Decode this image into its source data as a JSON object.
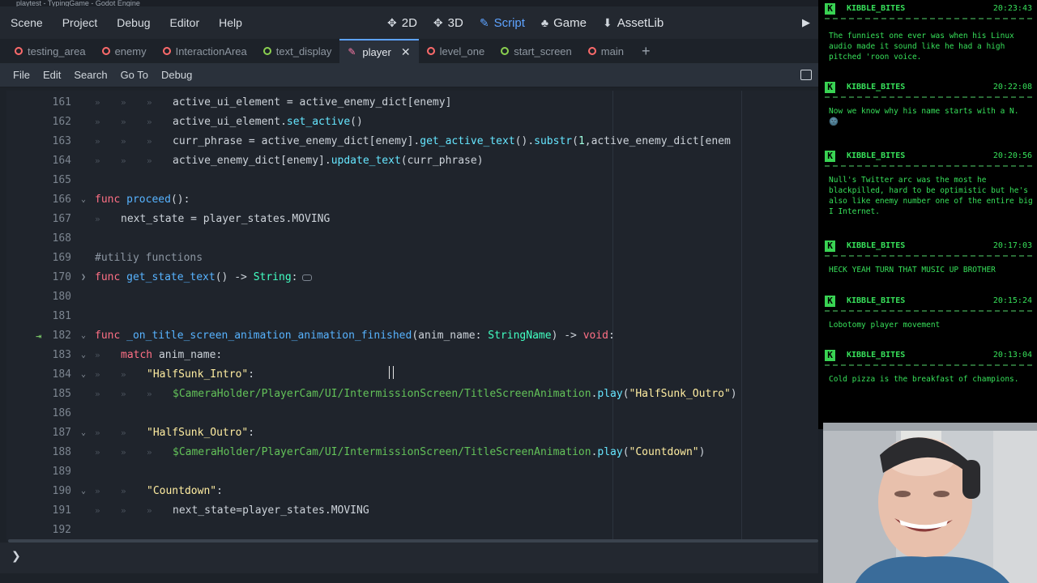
{
  "os_title": "playtest - TypingGame - Godot Engine",
  "menu": [
    "Scene",
    "Project",
    "Debug",
    "Editor",
    "Help"
  ],
  "workspaces": [
    {
      "icon": "✥",
      "label": "2D",
      "active": false
    },
    {
      "icon": "✥",
      "label": "3D",
      "active": false
    },
    {
      "icon": "✎",
      "label": "Script",
      "active": true
    },
    {
      "icon": "♣",
      "label": "Game",
      "active": false
    },
    {
      "icon": "⬇",
      "label": "AssetLib",
      "active": false
    }
  ],
  "tabs": [
    {
      "label": "testing_area",
      "color": "#ff6b6b",
      "active": false
    },
    {
      "label": "enemy",
      "color": "#ff6b6b",
      "active": false
    },
    {
      "label": "InteractionArea",
      "color": "#ff6b6b",
      "active": false
    },
    {
      "label": "text_display",
      "color": "#8bd150",
      "active": false
    },
    {
      "label": "player",
      "color": "#ff7aa8",
      "active": true
    },
    {
      "label": "level_one",
      "color": "#ff6b6b",
      "active": false
    },
    {
      "label": "start_screen",
      "color": "#8bd150",
      "active": false
    },
    {
      "label": "main",
      "color": "#ff6b6b",
      "active": false
    }
  ],
  "script_menu": [
    "File",
    "Edit",
    "Search",
    "Go To",
    "Debug"
  ],
  "code_lines": [
    {
      "n": "161",
      "indent": 3,
      "text": "active_ui_element = active_enemy_dict[enemy]"
    },
    {
      "n": "162",
      "indent": 3,
      "text": "active_ui_element.set_active()"
    },
    {
      "n": "163",
      "indent": 3,
      "text": "curr_phrase = active_enemy_dict[enemy].get_active_text().substr(1,active_enemy_dict[enem"
    },
    {
      "n": "164",
      "indent": 3,
      "text": "active_enemy_dict[enemy].update_text(curr_phrase)"
    },
    {
      "n": "165",
      "indent": 0,
      "text": ""
    },
    {
      "n": "166",
      "indent": 0,
      "text": "func proceed():"
    },
    {
      "n": "167",
      "indent": 1,
      "text": "next_state = player_states.MOVING"
    },
    {
      "n": "168",
      "indent": 0,
      "text": ""
    },
    {
      "n": "169",
      "indent": 0,
      "text": "#utiliy functions"
    },
    {
      "n": "170",
      "indent": 0,
      "text": "func get_state_text() -> String:"
    },
    {
      "n": "180",
      "indent": 0,
      "text": ""
    },
    {
      "n": "181",
      "indent": 0,
      "text": ""
    },
    {
      "n": "182",
      "indent": 0,
      "text": "func _on_title_screen_animation_animation_finished(anim_name: StringName) -> void:"
    },
    {
      "n": "183",
      "indent": 1,
      "text": "match anim_name:"
    },
    {
      "n": "184",
      "indent": 2,
      "text": "\"HalfSunk_Intro\":"
    },
    {
      "n": "185",
      "indent": 3,
      "text": "$CameraHolder/PlayerCam/UI/IntermissionScreen/TitleScreenAnimation.play(\"HalfSunk_Outro\")"
    },
    {
      "n": "186",
      "indent": 0,
      "text": ""
    },
    {
      "n": "187",
      "indent": 2,
      "text": "\"HalfSunk_Outro\":"
    },
    {
      "n": "188",
      "indent": 3,
      "text": "$CameraHolder/PlayerCam/UI/IntermissionScreen/TitleScreenAnimation.play(\"Countdown\")"
    },
    {
      "n": "189",
      "indent": 0,
      "text": ""
    },
    {
      "n": "190",
      "indent": 2,
      "text": "\"Countdown\":"
    },
    {
      "n": "191",
      "indent": 3,
      "text": "next_state=player_states.MOVING"
    },
    {
      "n": "192",
      "indent": 0,
      "text": ""
    }
  ],
  "chat": [
    {
      "user": "KIBBLE_BITES",
      "time": "20:23:43",
      "text": "The funniest one ever was when his Linux audio made it sound like he had a high pitched 'roon voice."
    },
    {
      "user": "KIBBLE_BITES",
      "time": "20:22:08",
      "text": "Now we know why his name starts with a N. 🌚"
    },
    {
      "user": "KIBBLE_BITES",
      "time": "20:20:56",
      "text": "Null's Twitter arc was the most he blackpilled, hard to be optimistic but he's also like enemy number one of the entire big I Internet."
    },
    {
      "user": "KIBBLE_BITES",
      "time": "20:17:03",
      "text": "HECK YEAH TURN THAT MUSIC UP BROTHER"
    },
    {
      "user": "KIBBLE_BITES",
      "time": "20:15:24",
      "text": "Lobotomy player movement"
    },
    {
      "user": "KIBBLE_BITES",
      "time": "20:13:04",
      "text": "Cold pizza is the breakfast of champions."
    }
  ],
  "badge_letter": "K"
}
